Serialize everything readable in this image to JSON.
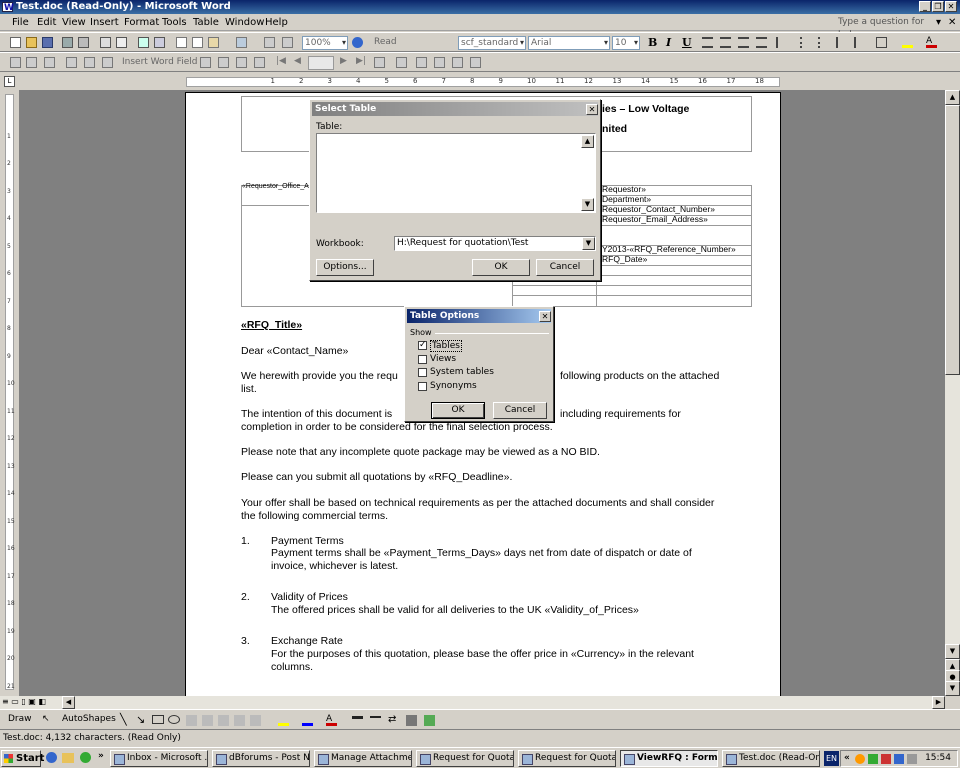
{
  "window": {
    "title": "Test.doc (Read-Only) - Microsoft Word"
  },
  "menus": [
    "File",
    "Edit",
    "View",
    "Insert",
    "Format",
    "Tools",
    "Table",
    "Window",
    "Help"
  ],
  "help_box": "Type a question for help",
  "toolbar": {
    "zoom": "100%",
    "read": "Read",
    "style": "scf_standard",
    "font": "Arial",
    "size": "10",
    "insert_field": "Insert Word Field"
  },
  "document": {
    "header_line1": "ies – Low Voltage",
    "header_line2": "nited",
    "requestor_office": "«Requestor_Office_A",
    "fields": [
      "Requestor»",
      "Department»",
      "Requestor_Contact_Number»",
      "Requestor_Email_Address»",
      "Y2013-«RFQ_Reference_Number»",
      "RFQ_Date»"
    ],
    "rfq_title": "«RFQ_Title»",
    "dear": "Dear «Contact_Name»",
    "para1a": "We herewith provide you the requ",
    "para1b": "following products on the attached",
    "para1c": "list.",
    "para2a": "The intention of this document is",
    "para2b": "including requirements for",
    "para2c": "completion in order to be considered for the final selection process.",
    "para3": "Please note that any incomplete quote package may be viewed as a NO BID.",
    "para4": "Please can you submit all quotations by «RFQ_Deadline».",
    "para5a": "Your offer shall be based on technical requirements as per the attached documents and shall consider",
    "para5b": "the following commercial terms.",
    "items": [
      {
        "num": "1.",
        "heading": "Payment Terms",
        "body1": "Payment terms shall be «Payment_Terms_Days» days net from date of dispatch or date of",
        "body2": "invoice, whichever is latest."
      },
      {
        "num": "2.",
        "heading": "Validity of Prices",
        "body1": "The offered prices shall be valid for all deliveries to the UK «Validity_of_Prices»",
        "body2": ""
      },
      {
        "num": "3.",
        "heading": "Exchange Rate",
        "body1": "For the purposes of this quotation, please base the offer price in «Currency» in the relevant",
        "body2": "columns."
      }
    ]
  },
  "select_table": {
    "title": "Select Table",
    "table_label": "Table:",
    "workbook_label": "Workbook:",
    "workbook_value": "H:\\Request for quotation\\Test",
    "options": "Options...",
    "ok": "OK",
    "cancel": "Cancel"
  },
  "table_options": {
    "title": "Table Options",
    "show": "Show",
    "checks": [
      {
        "label": "Tables",
        "checked": true
      },
      {
        "label": "Views",
        "checked": false
      },
      {
        "label": "System tables",
        "checked": false
      },
      {
        "label": "Synonyms",
        "checked": false
      }
    ],
    "ok": "OK",
    "cancel": "Cancel"
  },
  "drawbar": {
    "draw": "Draw",
    "autoshapes": "AutoShapes"
  },
  "status": "Test.doc: 4,132 characters.  (Read Only)",
  "taskbar": {
    "start": "Start",
    "tasks": [
      "Inbox - Microsoft ...",
      "dBforums - Post Ne...",
      "Manage Attachme...",
      "Request for Quota...",
      "Request for Quota...",
      "ViewRFQ : Form",
      "Test.doc (Read-On..."
    ],
    "lang": "EN",
    "clock": "15:54"
  }
}
